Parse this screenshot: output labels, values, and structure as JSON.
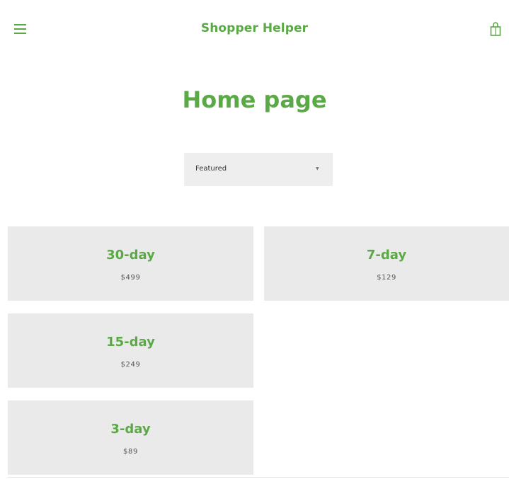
{
  "header": {
    "title": "Shopper Helper",
    "menu_icon": "hamburger-menu-icon",
    "cart_icon": "shopping-bag-icon"
  },
  "main": {
    "page_title": "Home page",
    "sort": {
      "selected": "Featured",
      "caret": "▼"
    },
    "products": [
      {
        "name": "30-day",
        "price": "$499"
      },
      {
        "name": "7-day",
        "price": "$129"
      },
      {
        "name": "15-day",
        "price": "$249"
      },
      {
        "name": "3-day",
        "price": "$89"
      }
    ]
  },
  "colors": {
    "accent": "#5aa946",
    "card_bg": "#eaeaea",
    "select_bg": "#eeeeee",
    "price_text": "#555555"
  }
}
